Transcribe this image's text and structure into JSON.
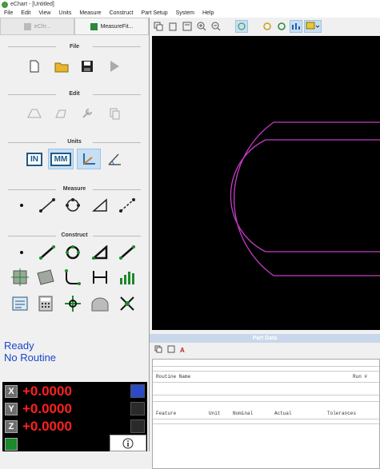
{
  "window": {
    "title": "eChart - [Untitled]"
  },
  "menu": [
    "File",
    "Edit",
    "View",
    "Units",
    "Measure",
    "Construct",
    "Part Setup",
    "System",
    "Help"
  ],
  "left_tabs": [
    {
      "label": "eChr...",
      "active": false
    },
    {
      "label": "MeasureFit...",
      "active": true
    }
  ],
  "sections": {
    "file": "File",
    "edit": "Edit",
    "units": "Units",
    "measure": "Measure",
    "construct": "Construct"
  },
  "units_buttons": [
    {
      "label": "IN"
    },
    {
      "label": "MM"
    }
  ],
  "status": {
    "line1": "Ready",
    "line2": "No Routine"
  },
  "dro": {
    "rows": [
      {
        "axis": "X",
        "value": "+0.0000"
      },
      {
        "axis": "Y",
        "value": "+0.0000"
      },
      {
        "axis": "Z",
        "value": "+0.0000"
      }
    ]
  },
  "right_toolbar_icons": [
    "copy-icon",
    "paste-icon",
    "window-icon",
    "zoom-in-icon",
    "zoom-out-icon",
    "target-icon",
    "circle-icon",
    "circle-alt-icon",
    "chart-icon",
    "comment-icon"
  ],
  "results": {
    "panel_title": "Part Data",
    "add_label": "A",
    "routine_label": "Routine Name",
    "run_label": "Run #",
    "columns": [
      "Feature",
      "Unit",
      "Nominal",
      "Actual",
      "Tolerances"
    ]
  },
  "colors": {
    "profile": "#c43cc4",
    "dro_value": "#ff2020",
    "status": "#1a46c8"
  }
}
